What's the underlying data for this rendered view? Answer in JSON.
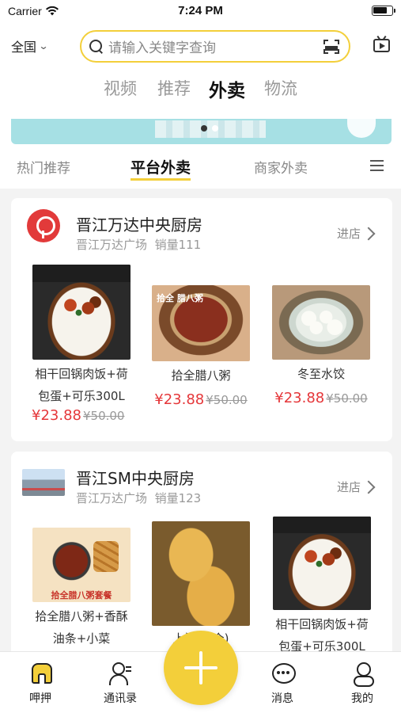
{
  "status_bar": {
    "carrier": "Carrier",
    "time": "7:24 PM"
  },
  "header": {
    "region": "全国",
    "search_placeholder": "请输入关键字查询"
  },
  "main_tabs": [
    "视频",
    "推荐",
    "外卖",
    "物流"
  ],
  "main_tabs_active": "外卖",
  "sub_tabs": [
    "热门推荐",
    "平台外卖",
    "商家外卖"
  ],
  "sub_tabs_active": "平台外卖",
  "shops": [
    {
      "name": "晋江万达中央厨房",
      "location": "晋江万达广场",
      "sales": "销量111",
      "enter_label": "进店",
      "products": [
        {
          "name_line1": "相干回锅肉饭+荷",
          "name_line2": "包蛋+可乐300L",
          "price": "¥23.88",
          "old_price": "¥50.00",
          "image_text": "多口味保选 蒸肉保充"
        },
        {
          "name_line1": "拾全腊八粥",
          "price": "¥23.88",
          "old_price": "¥50.00",
          "image_text": "拾全 腊八粥"
        },
        {
          "name_line1": "冬至水饺",
          "price": "¥23.88",
          "old_price": "¥50.00"
        }
      ]
    },
    {
      "name": "晋江SM中央厨房",
      "location": "晋江万达广场",
      "sales": "销量123",
      "enter_label": "进店",
      "products": [
        {
          "name_line1": "拾全腊八粥+香酥",
          "name_line2": "油条+小菜",
          "image_text": "拾全腊八粥套餐"
        },
        {
          "name_line1": "上汤...(个)"
        },
        {
          "name_line1": "相干回锅肉饭+荷",
          "name_line2": "包蛋+可乐300L",
          "image_text": "多口味保选 蒸肉保充"
        }
      ]
    }
  ],
  "tab_bar": {
    "items": [
      "呷押",
      "通讯录",
      "消息",
      "我的"
    ],
    "active": "呷押"
  },
  "colors": {
    "accent": "#f3cf3a",
    "price": "#e5373a",
    "banner": "#a6e0e4"
  }
}
